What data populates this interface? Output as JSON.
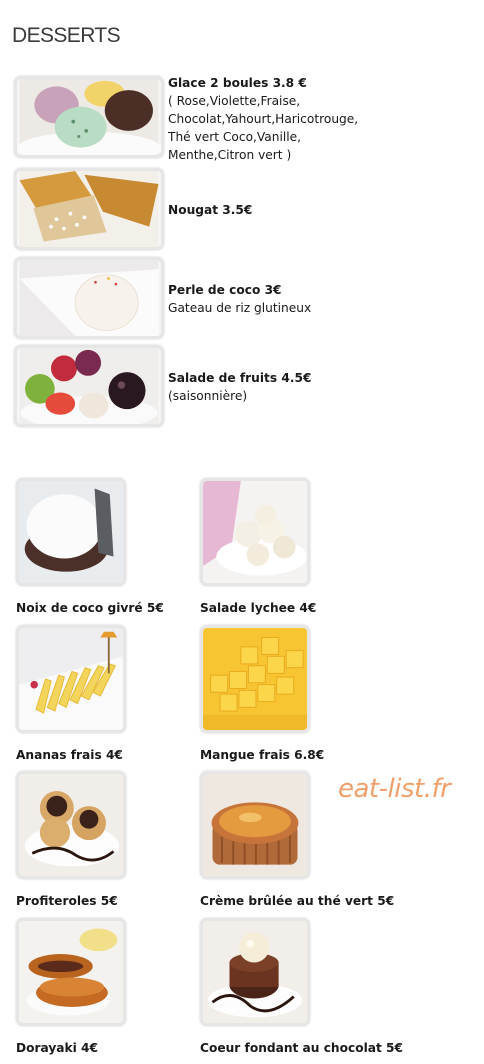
{
  "page": {
    "title": "DESSERTS",
    "watermark": "eat-list.fr"
  },
  "featured": [
    {
      "name": "Glace 2 boules 3.8 €",
      "desc": "( Rose,Violette,Fraise,\nChocolat,Yahourt,Haricotrouge,\nThé vert Coco,Vanille,\nMenthe,Citron vert )"
    },
    {
      "name": "Nougat 3.5€",
      "desc": ""
    },
    {
      "name": "Perle de coco 3€",
      "desc": "Gateau de riz glutineux"
    },
    {
      "name": "Salade de fruits 4.5€",
      "desc": "(saisonnière)"
    }
  ],
  "grid": [
    {
      "name": "Noix de coco givré 5€"
    },
    {
      "name": "Salade lychee 4€"
    },
    {
      "name": "Ananas frais 4€"
    },
    {
      "name": "Mangue frais 6.8€"
    },
    {
      "name": "Profiteroles 5€"
    },
    {
      "name": "Crème brûlée au thé vert 5€"
    },
    {
      "name": "Dorayaki 4€"
    },
    {
      "name": "Coeur fondant au chocolat 5€"
    }
  ]
}
